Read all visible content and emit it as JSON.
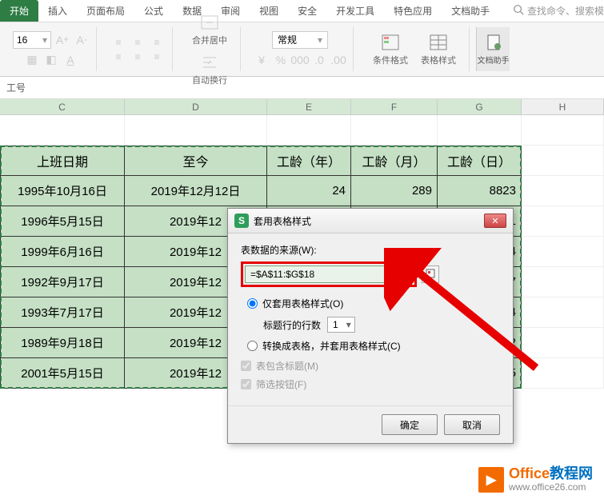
{
  "ribbon": {
    "tabs": [
      "开始",
      "插入",
      "页面布局",
      "公式",
      "数据",
      "审阅",
      "视图",
      "安全",
      "开发工具",
      "特色应用",
      "文档助手"
    ],
    "active_tab": "开始",
    "search_placeholder": "查找命令、搜索模",
    "font_size": "16",
    "number_format": "常规",
    "merge_label": "合并居中",
    "wrap_label": "自动换行",
    "cond_format_label": "条件格式",
    "table_style_label": "表格样式",
    "doc_helper_label": "文档助手"
  },
  "formula_bar": {
    "cell_ref": "工号"
  },
  "columns": [
    "C",
    "D",
    "E",
    "F",
    "G",
    "H"
  ],
  "headers": {
    "c": "上班日期",
    "d": "至今",
    "e": "工龄（年）",
    "f": "工龄（月）",
    "g": "工龄（日）"
  },
  "rows": [
    {
      "c": "1995年10月16日",
      "d": "2019年12月12日",
      "e": "24",
      "f": "289",
      "g": "8823"
    },
    {
      "c": "1996年5月15日",
      "d": "2019年12",
      "e": "",
      "f": "",
      "g": "8611"
    },
    {
      "c": "1999年6月16日",
      "d": "2019年12",
      "e": "",
      "f": "",
      "g": "7484"
    },
    {
      "c": "1992年9月17日",
      "d": "2019年12",
      "e": "",
      "f": "",
      "g": "9947"
    },
    {
      "c": "1993年7月17日",
      "d": "2019年12",
      "e": "",
      "f": "",
      "g": "9644"
    },
    {
      "c": "1989年9月18日",
      "d": "2019年12",
      "e": "",
      "f": "",
      "g": "1042"
    },
    {
      "c": "2001年5月15日",
      "d": "2019年12",
      "e": "",
      "f": "",
      "g": "6785"
    }
  ],
  "dialog": {
    "title": "套用表格样式",
    "source_label": "表数据的来源(W):",
    "range_value": "=$A$11:$G$18",
    "opt_style_only": "仅套用表格样式(O)",
    "title_rows_label": "标题行的行数",
    "title_rows_value": "1",
    "opt_convert": "转换成表格，并套用表格样式(C)",
    "chk_header": "表包含标题(M)",
    "chk_filter": "筛选按钮(F)",
    "ok": "确定",
    "cancel": "取消"
  },
  "watermark": {
    "title_a": "Office",
    "title_b": "教程网",
    "sub": "www.office26.com"
  }
}
